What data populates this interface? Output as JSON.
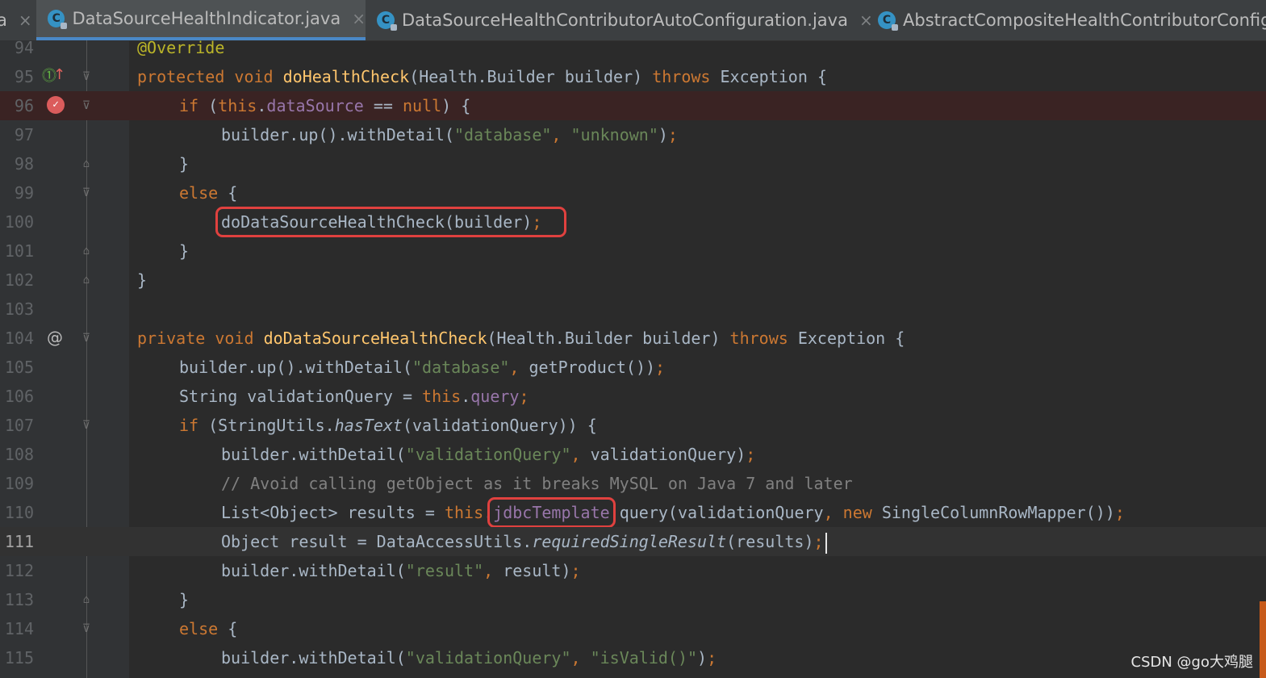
{
  "tabs": [
    {
      "label": "a",
      "partial": true
    },
    {
      "label": "DataSourceHealthIndicator.java",
      "active": true
    },
    {
      "label": "DataSourceHealthContributorAutoConfiguration.java"
    },
    {
      "label": "AbstractCompositeHealthContributorConfigu"
    }
  ],
  "class_icon_letter": "C",
  "close_glyph": "×",
  "lines": {
    "l94": {
      "n": "94"
    },
    "l95": {
      "n": "95"
    },
    "l96": {
      "n": "96"
    },
    "l97": {
      "n": "97"
    },
    "l98": {
      "n": "98"
    },
    "l99": {
      "n": "99"
    },
    "l100": {
      "n": "100"
    },
    "l101": {
      "n": "101"
    },
    "l102": {
      "n": "102"
    },
    "l103": {
      "n": "103"
    },
    "l104": {
      "n": "104"
    },
    "l105": {
      "n": "105"
    },
    "l106": {
      "n": "106"
    },
    "l107": {
      "n": "107"
    },
    "l108": {
      "n": "108"
    },
    "l109": {
      "n": "109"
    },
    "l110": {
      "n": "110"
    },
    "l111": {
      "n": "111"
    },
    "l112": {
      "n": "112"
    },
    "l113": {
      "n": "113"
    },
    "l114": {
      "n": "114"
    },
    "l115": {
      "n": "115"
    }
  },
  "tokens": {
    "override": "@Override",
    "protected": "protected",
    "void": "void",
    "private": "private",
    "doHealthCheck": "doHealthCheck",
    "healthBuilderParam": "(Health.Builder builder) ",
    "throws": "throws",
    "exceptionBrace": " Exception {",
    "if": "if",
    "openParen": " (",
    "this": "this",
    "dot": ".",
    "dataSource": "dataSource",
    "eqeq": " == ",
    "null": "null",
    "closeBrace1": ") {",
    "builderUpWithDetail": "builder.up().withDetail(",
    "strDatabase": "\"database\"",
    "comma": ", ",
    "strUnknown": "\"unknown\"",
    "closeParen": ")",
    "semicolon": ";",
    "rbrace": "}",
    "else": "else",
    "lbraceSp": " {",
    "doDataSourceHealthCheckCall": "doDataSourceHealthCheck(builder)",
    "doDataSourceHealthCheck": "doDataSourceHealthCheck",
    "getProduct": "getProduct())",
    "stringValidation": "String validationQuery = ",
    "query": "query",
    "stringUtils": " (StringUtils.",
    "hasText": "hasText",
    "hasTextArgs": "(validationQuery)) {",
    "builderWithDetail": "builder.withDetail(",
    "strValidationQuery": "\"validationQuery\"",
    "validationQueryArg": "validationQuery)",
    "comment": "// Avoid calling getObject as it breaks MySQL on Java 7 and later",
    "listObject": "List<Object> results = ",
    "jdbcTemplate": "jdbcTemplate",
    "queryCall": ".query(validationQuery",
    "new": "new",
    "singleColumn": " SingleColumnRowMapper())",
    "objectResult": "Object result = DataAccessUtils.",
    "requiredSingleResult": "requiredSingleResult",
    "resultsArg": "(results)",
    "strResult": "\"result\"",
    "resultArg": "result)",
    "strIsValid": "\"isValid()\"",
    "isValidClose": ")"
  },
  "watermark": "CSDN @go大鸡腿",
  "colors": {
    "background": "#2b2b2b",
    "keyword": "#cc7832",
    "string": "#6a8759",
    "field": "#9876aa",
    "method": "#ffc66d",
    "annotation": "#bbb529",
    "highlight_box": "#e0413f",
    "breakpoint_line": "#3a2323"
  }
}
